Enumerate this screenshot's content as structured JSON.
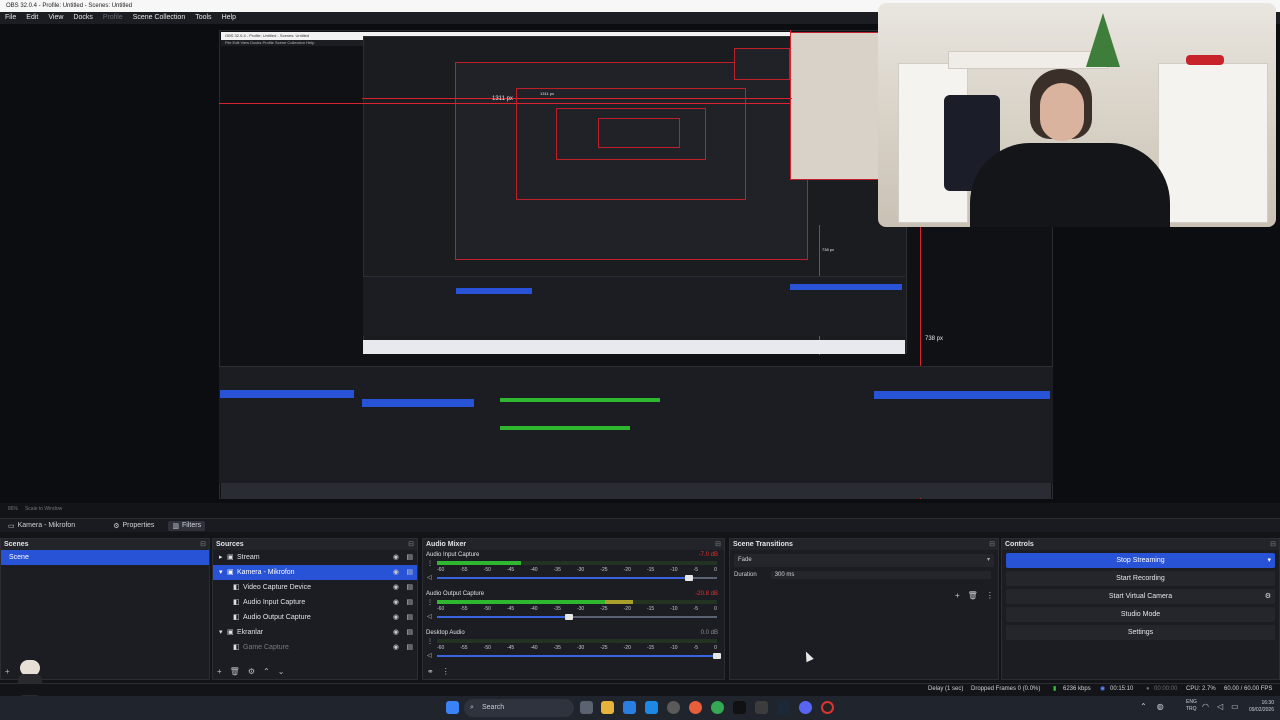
{
  "window": {
    "title": "OBS 32.0.4 - Profile: Untitled - Scenes: Untitled"
  },
  "menu": [
    "File",
    "Edit",
    "View",
    "Docks",
    "Profile",
    "Scene Collection",
    "Tools",
    "Help"
  ],
  "preview": {
    "mini_title": "OBS 32.0.4 - Profile: Untitled - Scenes: Untitled",
    "mini_menu": "File  Edit  View  Docks  Profile  Scene Collection  Help",
    "label_1311": "1311 px",
    "label_738": "738 px",
    "label_1311_small": "1311 px",
    "label_738_small": "738 px",
    "scale_label": "86%",
    "scale_mode": "Scale to Window"
  },
  "source_bar": {
    "current_source": "Kamera - Mikrofon",
    "properties": "Properties",
    "filters": "Filters"
  },
  "scenes": {
    "title": "Scenes",
    "items": [
      "Scene"
    ]
  },
  "sources": {
    "title": "Sources",
    "items": [
      {
        "label": "Stream",
        "indent": 0,
        "group": true,
        "expanded": false
      },
      {
        "label": "Kamera - Mikrofon",
        "indent": 0,
        "group": true,
        "expanded": true
      },
      {
        "label": "Video Capture Device",
        "indent": 1
      },
      {
        "label": "Audio Input Capture",
        "indent": 1
      },
      {
        "label": "Audio Output Capture",
        "indent": 1
      },
      {
        "label": "Ekranlar",
        "indent": 0,
        "group": true,
        "expanded": true
      },
      {
        "label": "Game Capture",
        "indent": 1,
        "dim": true
      }
    ]
  },
  "mixer": {
    "title": "Audio Mixer",
    "scale": [
      "-60",
      "-55",
      "-50",
      "-45",
      "-40",
      "-35",
      "-30",
      "-25",
      "-20",
      "-15",
      "-10",
      "-5",
      "0"
    ],
    "channels": [
      {
        "name": "Audio Input Capture",
        "db": "-7.0 dB",
        "level": 0.3,
        "fader": 0.9
      },
      {
        "name": "Audio Output Capture",
        "db": "-20.8 dB",
        "level": 0.7,
        "fader": 0.47
      },
      {
        "name": "Desktop Audio",
        "db": "0.0 dB",
        "level": 0.0,
        "fader": 1.0
      }
    ]
  },
  "transitions": {
    "title": "Scene Transitions",
    "selected": "Fade",
    "duration_label": "Duration",
    "duration_value": "300 ms"
  },
  "controls": {
    "title": "Controls",
    "buttons": [
      "Stop Streaming",
      "Start Recording",
      "Start Virtual Camera",
      "Studio Mode",
      "Settings"
    ]
  },
  "status": {
    "delay": "Delay (1 sec)",
    "dropped": "Dropped Frames 0 (0.0%)",
    "bitrate": "6236 kbps",
    "stream_time": "00:15:10",
    "rec_time": "00:00:00",
    "cpu": "CPU: 2.7%",
    "fps": "60.00 / 60.00 FPS"
  },
  "taskbar": {
    "search": "Search",
    "lang": "ENG",
    "lang2": "TRQ",
    "time": "16:30",
    "date": "09/02/2026"
  },
  "colors": {
    "accent": "#2853d6",
    "meter_green": "#2fb82f",
    "meter_yellow": "#a9a02b",
    "meter_red": "#9a2828",
    "guide_red": "#d8242f"
  }
}
